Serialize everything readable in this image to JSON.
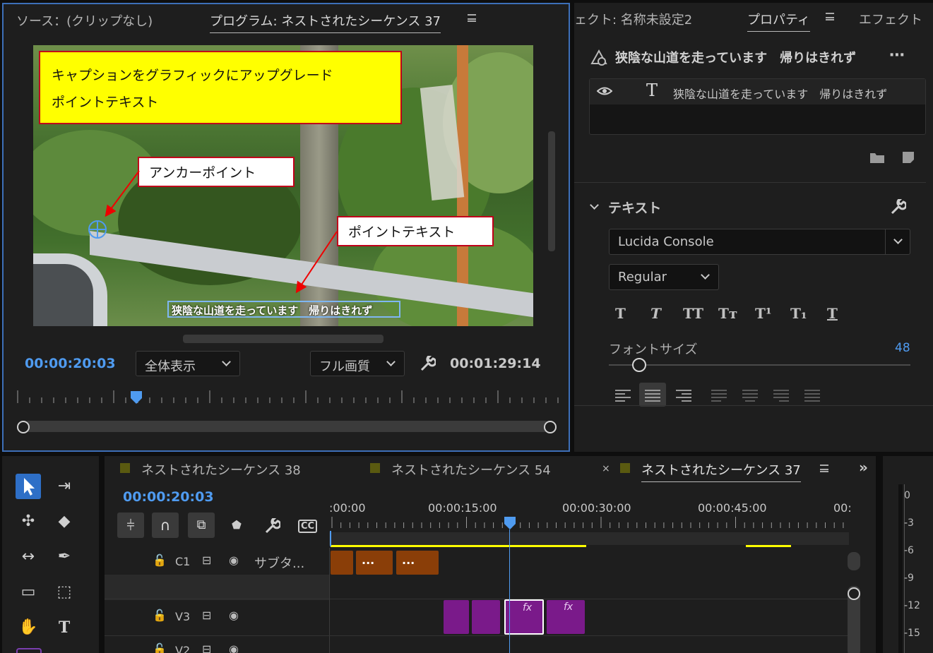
{
  "monitor": {
    "source_tab": "ソース：(クリップなし)",
    "program_tab": "プログラム: ネストされたシーケンス 37",
    "current_time": "00:00:20:03",
    "zoom_select": "全体表示",
    "quality_select": "フル画質",
    "duration": "00:01:29:14"
  },
  "callouts": {
    "title_line1": "キャプションをグラフィックにアップグレード",
    "title_line2": "ポイントテキスト",
    "anchor": "アンカーポイント",
    "point_text": "ポイントテキスト"
  },
  "video_caption": "狭陰な山道を走っています　帰りはきれず",
  "properties": {
    "tab_effect_controls": "ェクト: 名称未設定2",
    "tab_properties": "プロパティ",
    "tab_effects": "エフェクト",
    "layer_title": "狭陰な山道を走っています　帰りはきれず",
    "layer_item": "狭陰な山道を走っています　帰りはきれず",
    "text_section": "テキスト",
    "font_family": "Lucida Console",
    "font_style": "Regular",
    "font_size_label": "フォントサイズ",
    "font_size_value": "48",
    "font_size_fraction": 0.1
  },
  "timeline": {
    "tabs": [
      "ネストされたシーケンス 38",
      "ネストされたシーケンス 54",
      "ネストされたシーケンス 37"
    ],
    "current_time": "00:00:20:03",
    "ruler": [
      ":00:00",
      "00:00:15:00",
      "00:00:30:00",
      "00:00:45:00",
      "00:"
    ],
    "tracks": [
      {
        "lock": "🔓",
        "name": "C1",
        "label": "サブタ..."
      },
      {
        "lock": "🔓",
        "name": "V3",
        "label": ""
      },
      {
        "lock": "🔓",
        "name": "V2",
        "label": ""
      }
    ],
    "caption_clip_text": "...",
    "fx_label": "fx"
  },
  "meter": {
    "scale": [
      "0",
      "-3",
      "-6",
      "-9",
      "-12",
      "-15"
    ]
  },
  "colors": {
    "accent_blue": "#4f9bf0",
    "caption_clip": "#8a3e08",
    "video_clip": "#7a1a8a",
    "highlight_yellow": "#ffff00",
    "callout_border": "#c0001a"
  }
}
